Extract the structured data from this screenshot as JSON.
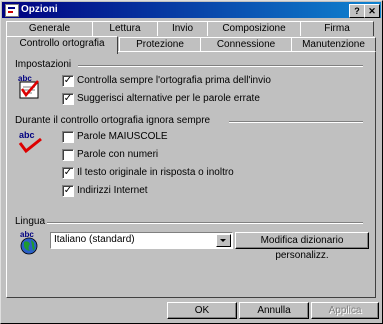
{
  "window": {
    "title": "Opzioni",
    "help_label": "?",
    "close_label": "✕"
  },
  "tabs_row1": [
    "Generale",
    "Lettura",
    "Invio",
    "Composizione",
    "Firma"
  ],
  "tabs_row2": [
    "Controllo ortografia",
    "Protezione",
    "Connessione",
    "Manutenzione"
  ],
  "active_tab": "Controllo ortografia",
  "impostazioni": {
    "heading": "Impostazioni",
    "options": [
      {
        "label": "Controlla sempre l'ortografia prima dell'invio",
        "checked": true
      },
      {
        "label": "Suggerisci alternative per le parole errate",
        "checked": true
      }
    ]
  },
  "ignora": {
    "heading": "Durante il controllo ortografia ignora sempre",
    "options": [
      {
        "label": "Parole MAIUSCOLE",
        "checked": false
      },
      {
        "label": "Parole con numeri",
        "checked": false
      },
      {
        "label": "Il testo originale in risposta o inoltro",
        "checked": true
      },
      {
        "label": "Indirizzi Internet",
        "checked": true
      }
    ]
  },
  "lingua": {
    "heading": "Lingua",
    "selected": "Italiano (standard)",
    "dictionary_button": "Modifica dizionario personalizz."
  },
  "icons": {
    "spell_icon": "abc-spellcheck-icon",
    "language_icon": "abc-globe-icon"
  },
  "footer": {
    "ok": "OK",
    "cancel": "Annulla",
    "apply": "Applica"
  }
}
